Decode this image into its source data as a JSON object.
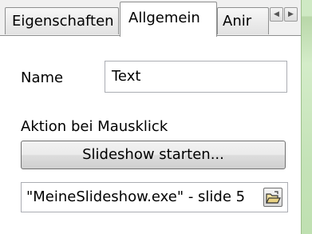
{
  "tabs": [
    {
      "label": "Eigenschaften",
      "active": false
    },
    {
      "label": "Allgemein",
      "active": true
    },
    {
      "label": "Anir",
      "active": false
    }
  ],
  "tab_scroll": {
    "left_icon": "triangle-left",
    "right_icon": "triangle-right"
  },
  "form": {
    "name_label": "Name",
    "name_value": "Text",
    "action_label": "Aktion bei Mausklick",
    "start_button_label": "Slideshow starten...",
    "path_value": "\"MeineSlideshow.exe\" - slide 5",
    "browse_icon": "folder-open-icon"
  }
}
